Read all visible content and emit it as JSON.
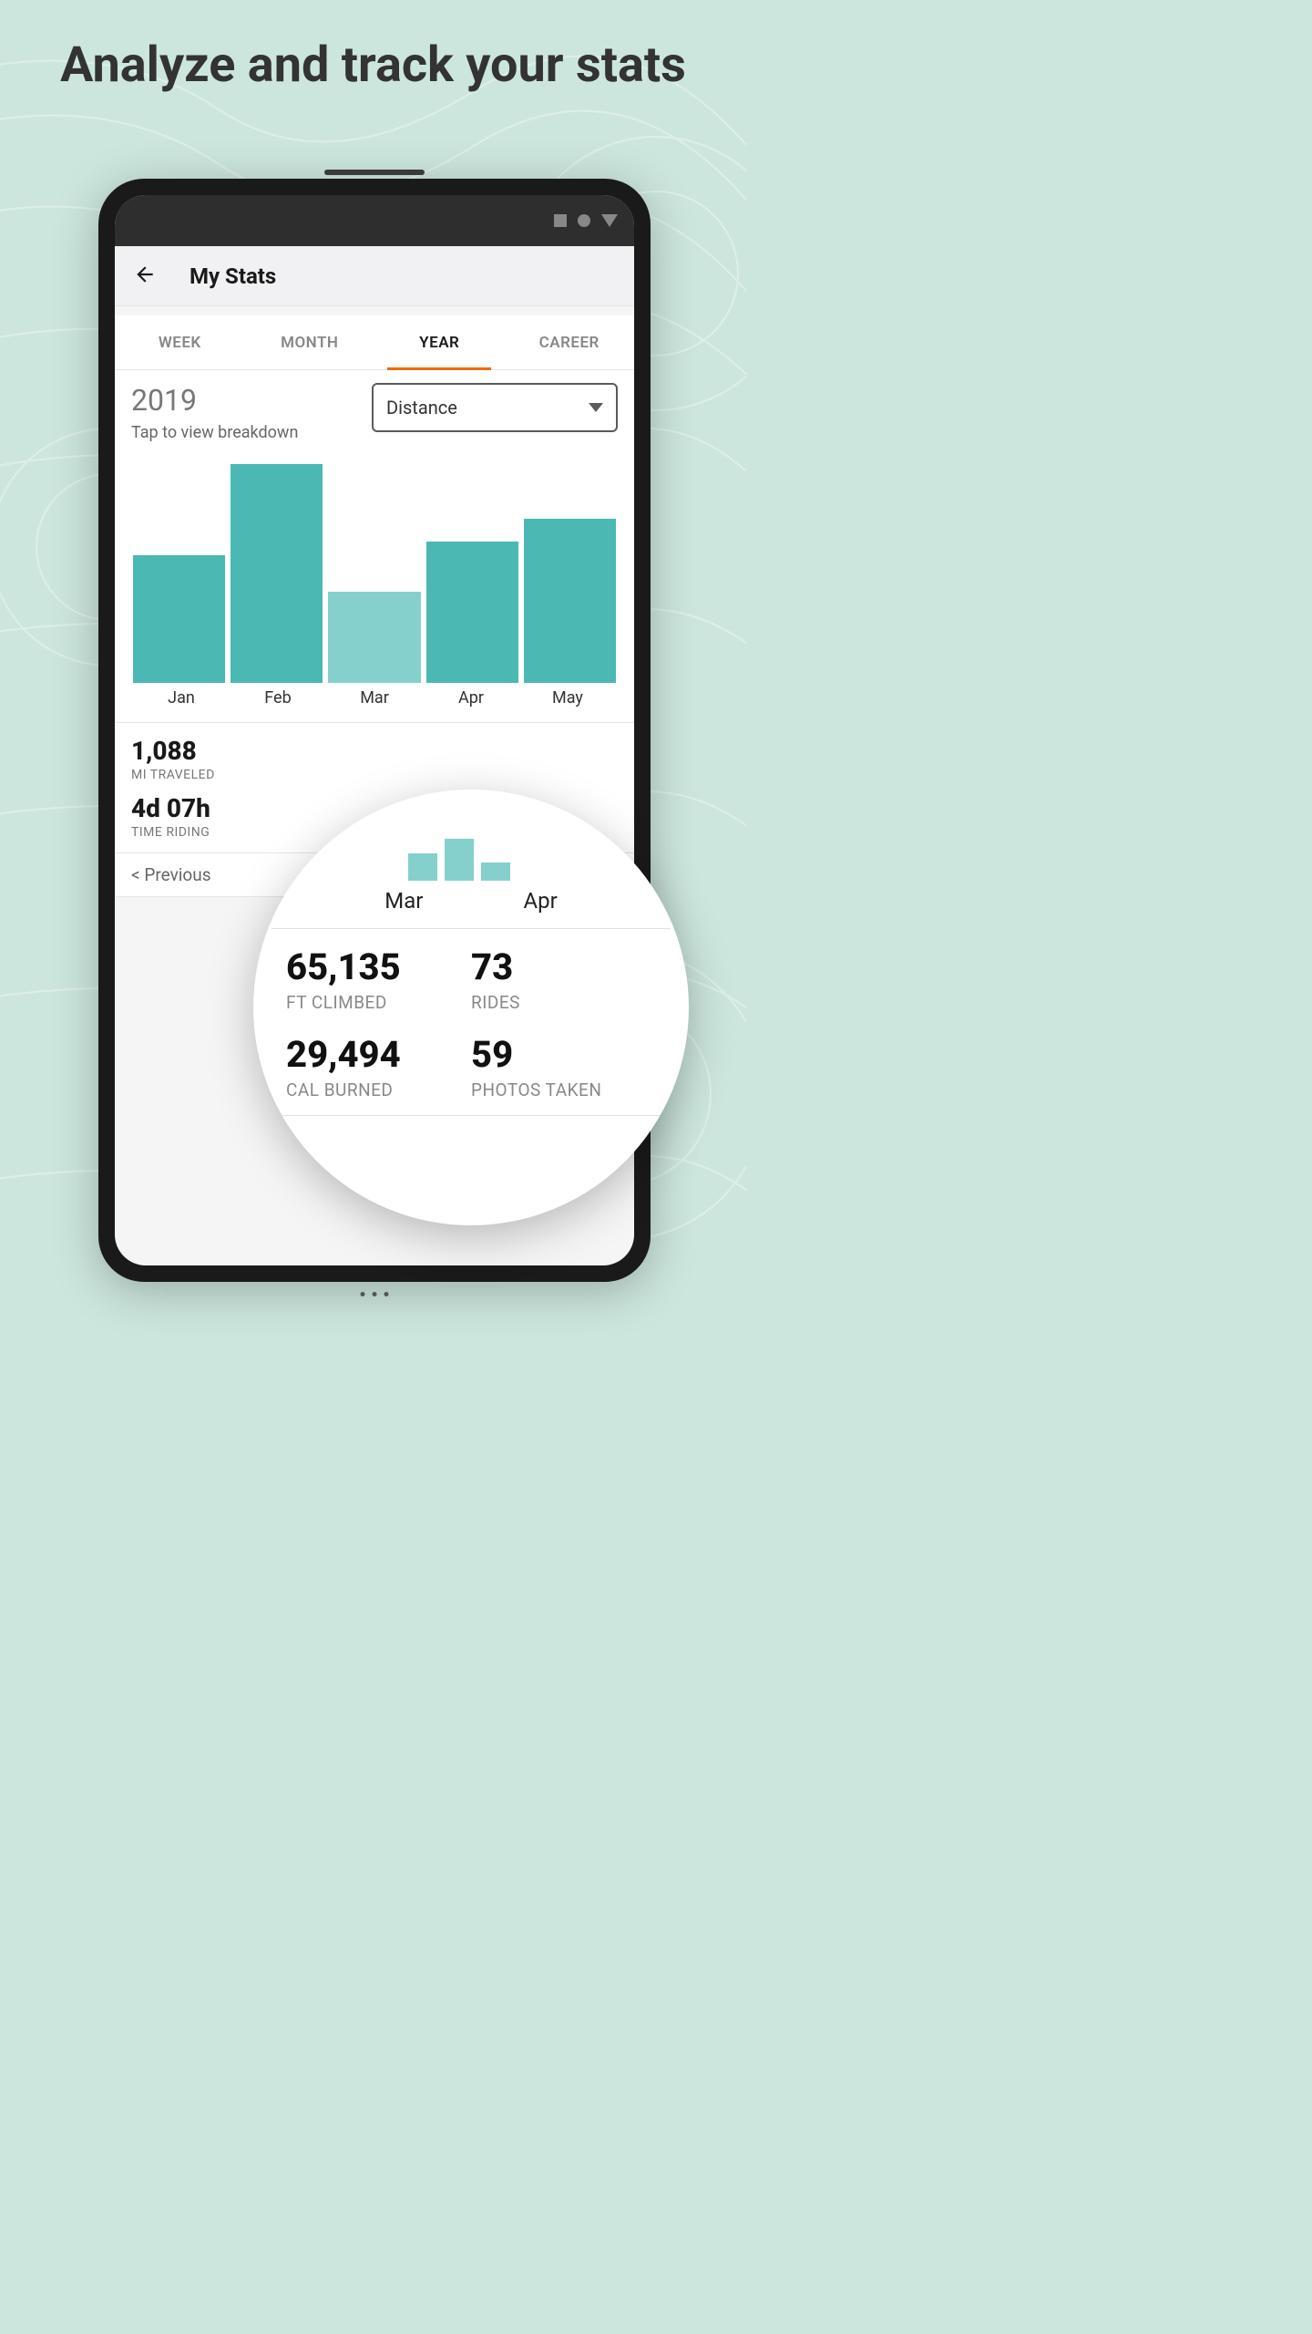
{
  "promo_title": "Analyze and track your stats",
  "appbar": {
    "title": "My Stats"
  },
  "tabs": {
    "items": [
      {
        "label": "WEEK"
      },
      {
        "label": "MONTH"
      },
      {
        "label": "YEAR"
      },
      {
        "label": "CAREER"
      }
    ],
    "active_index": 2
  },
  "year": {
    "value": "2019",
    "subtitle": "Tap to view breakdown"
  },
  "dropdown": {
    "selected": "Distance"
  },
  "chart_data": {
    "type": "bar",
    "categories": [
      "Jan",
      "Feb",
      "Mar",
      "Apr",
      "May"
    ],
    "values": [
      140,
      240,
      100,
      155,
      180
    ],
    "title": "",
    "xlabel": "",
    "ylabel": "",
    "ylim": [
      0,
      250
    ]
  },
  "stats": {
    "mi_traveled": {
      "value": "1,088",
      "label": "MI TRAVELED"
    },
    "time_riding": {
      "value": "4d 07h",
      "label": "TIME RIDING"
    }
  },
  "prev_link": "< Previous",
  "magnifier": {
    "bar_labels": [
      "Mar",
      "Apr"
    ],
    "ft_climbed": {
      "value": "65,135",
      "label": "FT CLIMBED"
    },
    "rides": {
      "value": "73",
      "label": "RIDES"
    },
    "cal_burned": {
      "value": "29,494",
      "label": "CAL BURNED"
    },
    "photos_taken": {
      "value": "59",
      "label": "PHOTOS TAKEN"
    }
  }
}
